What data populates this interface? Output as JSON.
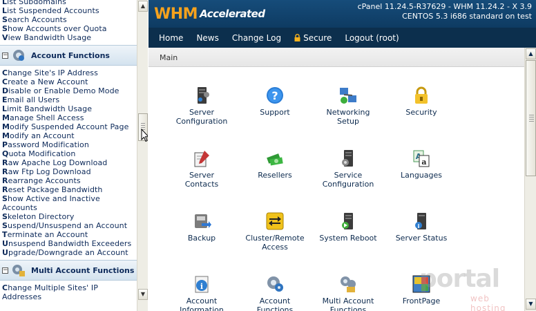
{
  "sidebar": {
    "top_links": [
      {
        "ini": "L",
        "rest": "ist Subdomains"
      },
      {
        "ini": "L",
        "rest": "ist Suspended Accounts"
      },
      {
        "ini": "S",
        "rest": "earch Accounts"
      },
      {
        "ini": "S",
        "rest": "how Accounts over Quota"
      },
      {
        "ini": "V",
        "rest": "iew Bandwidth Usage"
      }
    ],
    "section_account": {
      "title": "Account Functions",
      "toggle": "−",
      "links": [
        {
          "ini": "C",
          "rest": "hange Site's IP Address"
        },
        {
          "ini": "C",
          "rest": "reate a New Account"
        },
        {
          "ini": "D",
          "rest": "isable or Enable Demo Mode"
        },
        {
          "ini": "E",
          "rest": "mail all Users"
        },
        {
          "ini": "L",
          "rest": "imit Bandwidth Usage"
        },
        {
          "ini": "M",
          "rest": "anage Shell Access"
        },
        {
          "ini": "M",
          "rest": "odify Suspended Account Page"
        },
        {
          "ini": "M",
          "rest": "odify an Account"
        },
        {
          "ini": "P",
          "rest": "assword Modification"
        },
        {
          "ini": "Q",
          "rest": "uota Modification"
        },
        {
          "ini": "R",
          "rest": "aw Apache Log Download"
        },
        {
          "ini": "R",
          "rest": "aw Ftp Log Download"
        },
        {
          "ini": "R",
          "rest": "earrange Accounts"
        },
        {
          "ini": "R",
          "rest": "eset Package Bandwidth"
        },
        {
          "ini": "S",
          "rest": "how Active and Inactive"
        },
        {
          "ini": "",
          "rest": "Accounts"
        },
        {
          "ini": "S",
          "rest": "keleton Directory"
        },
        {
          "ini": "S",
          "rest": "uspend/Unsuspend an Account"
        },
        {
          "ini": "T",
          "rest": "erminate an Account"
        },
        {
          "ini": "U",
          "rest": "nsuspend Bandwidth Exceeders"
        },
        {
          "ini": "U",
          "rest": "pgrade/Downgrade an Account"
        }
      ]
    },
    "section_multi": {
      "title": "Multi Account Functions",
      "toggle": "−",
      "links": [
        {
          "ini": "C",
          "rest": "hange Multiple Sites' IP"
        },
        {
          "ini": "",
          "rest": "Addresses"
        }
      ]
    }
  },
  "header": {
    "logo_whm": "WHM",
    "logo_accelerated": "Accelerated",
    "server_line1": "cPanel 11.24.5-R37629 - WHM 11.24.2 - X 3.9",
    "server_line2": "CENTOS 5.3 i686 standard on test"
  },
  "nav": {
    "home": "Home",
    "news": "News",
    "changelog": "Change Log",
    "secure": "Secure",
    "logout": "Logout (root)"
  },
  "breadcrumb": "Main",
  "tiles": [
    {
      "name": "server-configuration",
      "icon": "server-icon",
      "line1": "Server",
      "line2": "Configuration"
    },
    {
      "name": "support",
      "icon": "help-icon",
      "line1": "Support",
      "line2": ""
    },
    {
      "name": "networking-setup",
      "icon": "network-icon",
      "line1": "Networking",
      "line2": "Setup"
    },
    {
      "name": "security",
      "icon": "lock-icon",
      "line1": "Security",
      "line2": ""
    },
    {
      "name": "server-contacts",
      "icon": "contacts-icon",
      "line1": "Server",
      "line2": "Contacts"
    },
    {
      "name": "resellers",
      "icon": "money-icon",
      "line1": "Resellers",
      "line2": ""
    },
    {
      "name": "service-configuration",
      "icon": "service-server-icon",
      "line1": "Service",
      "line2": "Configuration"
    },
    {
      "name": "languages",
      "icon": "languages-icon",
      "line1": "Languages",
      "line2": ""
    },
    {
      "name": "backup",
      "icon": "backup-icon",
      "line1": "Backup",
      "line2": ""
    },
    {
      "name": "cluster-remote-access",
      "icon": "cluster-icon",
      "line1": "Cluster/Remote",
      "line2": "Access"
    },
    {
      "name": "system-reboot",
      "icon": "reboot-icon",
      "line1": "System Reboot",
      "line2": ""
    },
    {
      "name": "server-status",
      "icon": "status-icon",
      "line1": "Server Status",
      "line2": ""
    },
    {
      "name": "account-information",
      "icon": "account-info-icon",
      "line1": "Account",
      "line2": "Information"
    },
    {
      "name": "account-functions",
      "icon": "account-functions-icon",
      "line1": "Account",
      "line2": "Functions"
    },
    {
      "name": "multi-account-functions",
      "icon": "multi-account-icon",
      "line1": "Multi Account",
      "line2": "Functions"
    },
    {
      "name": "frontpage",
      "icon": "frontpage-icon",
      "line1": "FrontPage",
      "line2": ""
    }
  ],
  "watermark": {
    "main": "portal",
    "sub": "web hosting"
  },
  "colors": {
    "header": "#164c7a",
    "navbar": "#0c2f4d",
    "logo_orange": "#f6a21d",
    "link_text": "#0d2a5a"
  }
}
